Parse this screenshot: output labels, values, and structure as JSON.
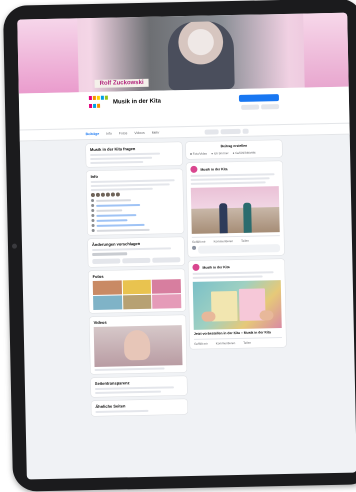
{
  "cover": {
    "name_banner": "Rolf Zuckowski",
    "logo_text": "MUSIK"
  },
  "page": {
    "title": "Musik in der Kita"
  },
  "nav": {
    "tabs": [
      "Beiträge",
      "Info",
      "Fotos",
      "Videos",
      "Mehr"
    ]
  },
  "left": {
    "intro_title": "Musik in der Kita fragen",
    "info_title": "Info",
    "suggestions_title": "Änderungen vorschlagen",
    "photos_title": "Fotos",
    "videos_title": "Videos",
    "transparency_title": "Seitentransparenz",
    "similar_title": "Ähnliche Seiten"
  },
  "right": {
    "create_post": "Beitrag erstellen",
    "post_author": "Musik in der Kita",
    "composer": {
      "photo_video": "Foto/Video",
      "check_in": "Ich bin hier",
      "feeling": "Gefühl/Aktivität"
    },
    "reactions": {
      "like": "Gefällt mir",
      "comment": "Kommentieren",
      "share": "Teilen"
    },
    "second_post_caption": "Jetzt vorbestellen in der Kita – Musik in der Kita"
  },
  "colors": {
    "accent": "#1877f2",
    "brand_pink": "#b0227a",
    "background": "#f0f2f5"
  }
}
